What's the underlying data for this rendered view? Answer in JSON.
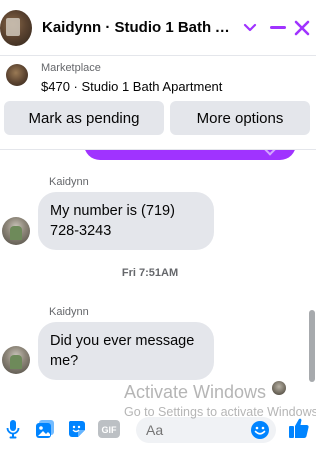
{
  "header": {
    "title": "Kaidynn · Studio 1 Bath Apartment",
    "accent_color": "#a033ff",
    "icons": [
      "chevron-down-icon",
      "minimize-icon",
      "close-icon"
    ]
  },
  "listing": {
    "source_label": "Marketplace",
    "title": "$470 · Studio 1 Bath Apartment",
    "mark_pending_label": "Mark as pending",
    "more_options_label": "More options"
  },
  "messages": [
    {
      "sender": "Kaidynn",
      "text": "My number is (719) 728-3243"
    },
    {
      "sender": "Kaidynn",
      "text": "Did you ever message me?"
    }
  ],
  "timestamp": "Fri 7:51AM",
  "composer": {
    "placeholder": "Aa",
    "icons": [
      "microphone-icon",
      "photo-icon",
      "sticker-icon",
      "gif-icon",
      "emoji-icon",
      "thumbs-up-icon"
    ]
  },
  "watermark": {
    "title": "Activate Windows",
    "subtitle": "Go to Settings to activate Windows."
  },
  "colors": {
    "accent": "#a033ff",
    "icon_blue": "#0084ff",
    "bubble_gray": "#e4e6eb"
  }
}
